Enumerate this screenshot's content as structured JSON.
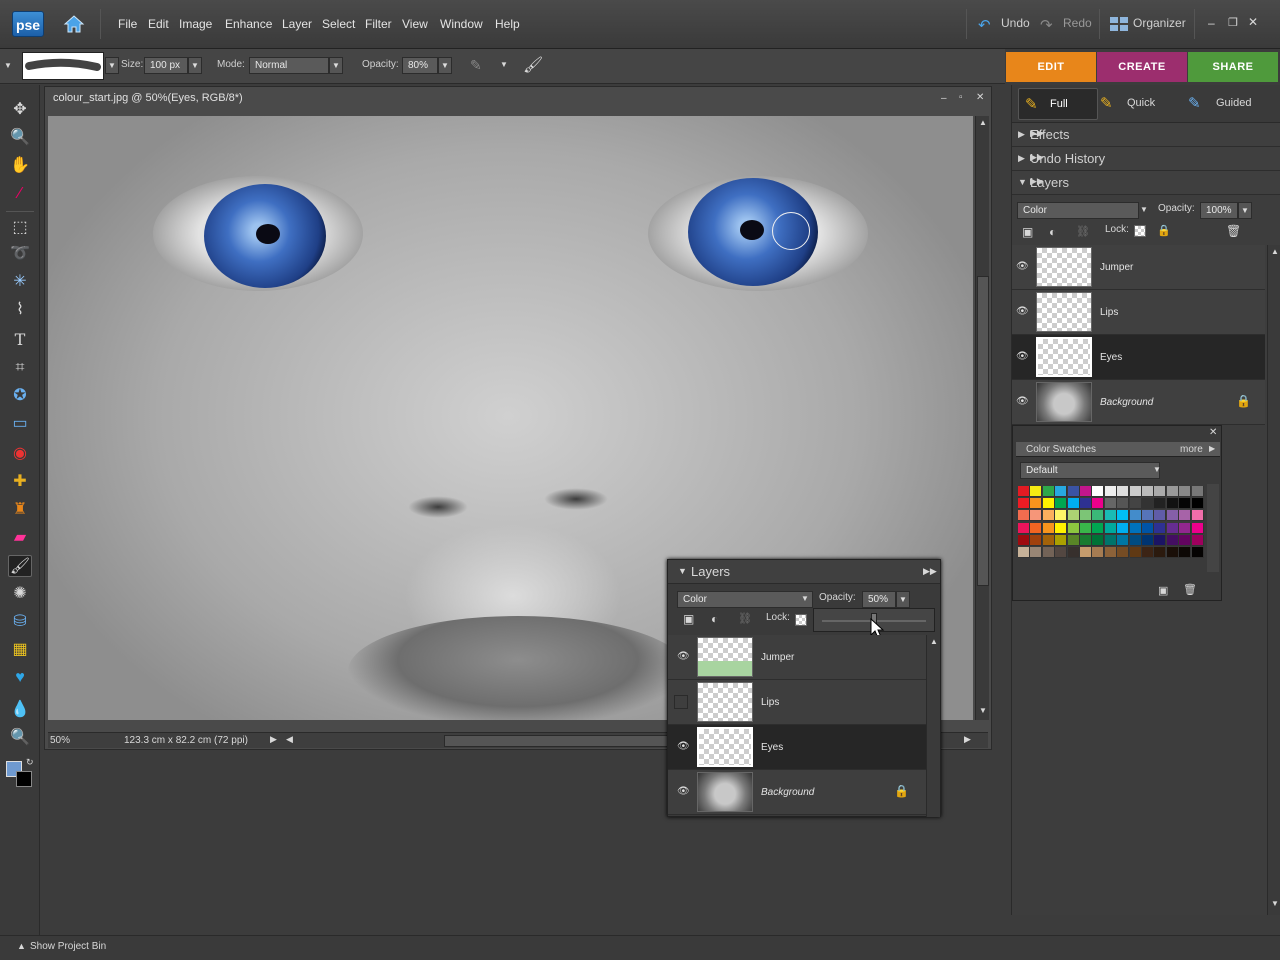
{
  "app": {
    "logo": "pse"
  },
  "menu": [
    "File",
    "Edit",
    "Image",
    "Enhance",
    "Layer",
    "Select",
    "Filter",
    "View",
    "Window",
    "Help"
  ],
  "topbar": {
    "undo": "Undo",
    "redo": "Redo",
    "organizer": "Organizer"
  },
  "options": {
    "size_label": "Size:",
    "size_value": "100 px",
    "mode_label": "Mode:",
    "mode_value": "Normal",
    "opacity_label": "Opacity:",
    "opacity_value": "80%"
  },
  "modes": [
    "EDIT",
    "CREATE",
    "SHARE"
  ],
  "mode_colors": {
    "edit": "#e8861a",
    "create": "#9c2e6e",
    "share": "#4f9a3c"
  },
  "edit_tabs": [
    "Full",
    "Quick",
    "Guided"
  ],
  "document": {
    "title": "colour_start.jpg @ 50%(Eyes, RGB/8*)",
    "zoom": "50%",
    "dimensions": "123.3 cm x 82.2 cm (72 ppi)"
  },
  "panels": {
    "effects": "Effects",
    "undo_history": "Undo History",
    "layers": "Layers"
  },
  "layers_panel": {
    "blend_mode": "Color",
    "opacity_label": "Opacity:",
    "opacity_value": "100%",
    "lock_label": "Lock:",
    "layers": [
      {
        "name": "Jumper",
        "visible": true
      },
      {
        "name": "Lips",
        "visible": true
      },
      {
        "name": "Eyes",
        "visible": true,
        "selected": true
      },
      {
        "name": "Background",
        "visible": true,
        "locked": true
      }
    ]
  },
  "swatches": {
    "tab": "Color Swatches",
    "more": "more",
    "preset": "Default",
    "colors": [
      [
        "#e31b23",
        "#f6eb13",
        "#2ea84a",
        "#27a9e1",
        "#3a53a4",
        "#c2168c",
        "#ffffff",
        "#eeeeee",
        "#dddddd",
        "#cccccc",
        "#bbbbbb",
        "#aaaaaa",
        "#999999",
        "#888888",
        "#777777"
      ],
      [
        "#ed1c24",
        "#f7941d",
        "#fff200",
        "#00a651",
        "#00aeef",
        "#2e3192",
        "#ec008c",
        "#666666",
        "#555555",
        "#444444",
        "#333333",
        "#222222",
        "#111111",
        "#050505",
        "#000000"
      ],
      [
        "#f26c4f",
        "#f69679",
        "#fbaf5d",
        "#fff568",
        "#acd373",
        "#7cc576",
        "#3bb878",
        "#1abbb4",
        "#00bff3",
        "#438ccb",
        "#5674b9",
        "#605ca8",
        "#855fa8",
        "#a763a8",
        "#f06ea9"
      ],
      [
        "#ed145b",
        "#f26522",
        "#f7941d",
        "#fff200",
        "#8dc63f",
        "#39b54a",
        "#00a651",
        "#00a99d",
        "#00aeef",
        "#0072bc",
        "#0054a6",
        "#2e3192",
        "#662d91",
        "#92278f",
        "#ec008c"
      ],
      [
        "#9e0b0f",
        "#a0410d",
        "#a36209",
        "#aba000",
        "#598527",
        "#197b30",
        "#007236",
        "#00746b",
        "#0076a3",
        "#004b80",
        "#003471",
        "#1b1464",
        "#440e62",
        "#630460",
        "#9e005d"
      ],
      [
        "#c7b299",
        "#998675",
        "#736357",
        "#534741",
        "#37302d",
        "#c69c6d",
        "#a67c52",
        "#8c6239",
        "#754c24",
        "#603913",
        "#3c2415",
        "#2b1a0e",
        "#1a0f08",
        "#0d0805",
        "#050302"
      ]
    ]
  },
  "floating_layers": {
    "title": "Layers",
    "blend_mode": "Color",
    "opacity_label": "Opacity:",
    "opacity_value": "50%",
    "opacity_fraction": 0.5,
    "lock_label": "Lock:",
    "layers": [
      {
        "name": "Jumper",
        "visible": true
      },
      {
        "name": "Lips",
        "visible": false
      },
      {
        "name": "Eyes",
        "visible": true,
        "selected": true
      },
      {
        "name": "Background",
        "visible": true,
        "locked": true
      }
    ]
  },
  "bottom": {
    "project_bin": "Show Project Bin"
  }
}
